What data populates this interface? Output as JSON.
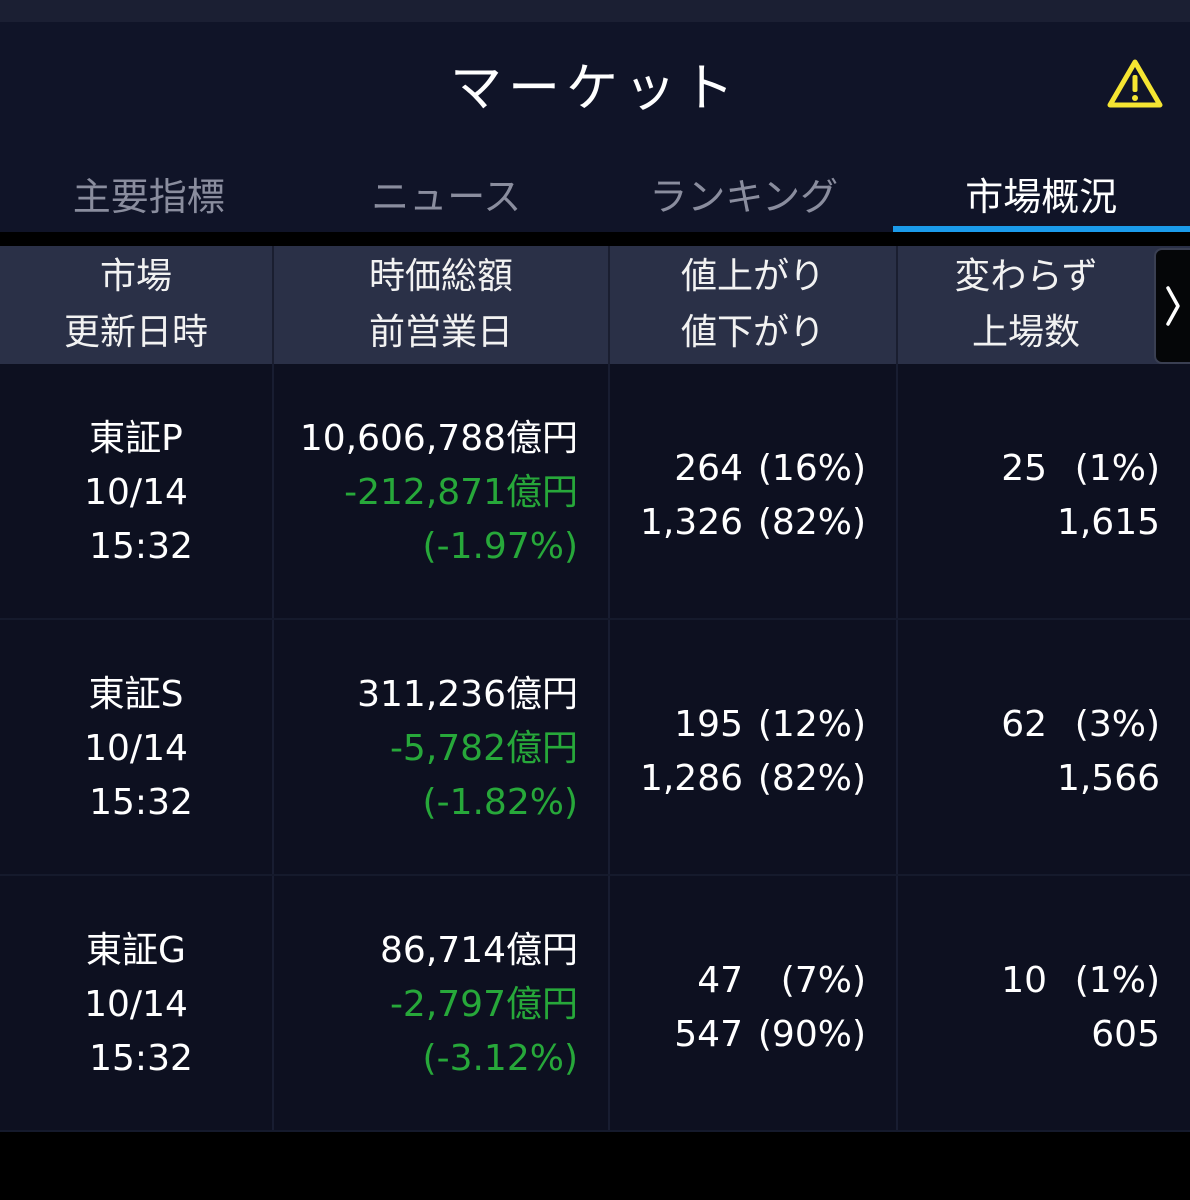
{
  "header": {
    "title": "マーケット",
    "warning_icon": "warning-triangle-icon",
    "warning_color": "#f5e532"
  },
  "tabs": [
    {
      "label": "主要指標",
      "active": false
    },
    {
      "label": "ニュース",
      "active": false
    },
    {
      "label": "ランキング",
      "active": false
    },
    {
      "label": "市場概況",
      "active": true
    }
  ],
  "accent_color": "#1b9bea",
  "table": {
    "columns": [
      {
        "line1": "市場",
        "line2": "更新日時"
      },
      {
        "line1": "時価総額",
        "line2": "前営業日"
      },
      {
        "line1": "値上がり",
        "line2": "値下がり"
      },
      {
        "line1": "変わらず",
        "line2": "上場数"
      }
    ],
    "next_icon": "chevron-right-icon",
    "rows": [
      {
        "market": "東証P",
        "date": "10/14",
        "time": "15:32",
        "cap": "10,606,788億円",
        "change": "-212,871億円",
        "change_pct": "(-1.97%)",
        "up": "264",
        "up_pct": "(16%)",
        "down": "1,326",
        "down_pct": "(82%)",
        "unchanged": "25",
        "unchanged_pct": "(1%)",
        "listed": "1,615"
      },
      {
        "market": "東証S",
        "date": "10/14",
        "time": "15:32",
        "cap": "311,236億円",
        "change": "-5,782億円",
        "change_pct": "(-1.82%)",
        "up": "195",
        "up_pct": "(12%)",
        "down": "1,286",
        "down_pct": "(82%)",
        "unchanged": "62",
        "unchanged_pct": "(3%)",
        "listed": "1,566"
      },
      {
        "market": "東証G",
        "date": "10/14",
        "time": "15:32",
        "cap": "86,714億円",
        "change": "-2,797億円",
        "change_pct": "(-3.12%)",
        "up": "47",
        "up_pct": "(7%)",
        "down": "547",
        "down_pct": "(90%)",
        "unchanged": "10",
        "unchanged_pct": "(1%)",
        "listed": "605"
      }
    ]
  },
  "change_color": "#27a83a"
}
